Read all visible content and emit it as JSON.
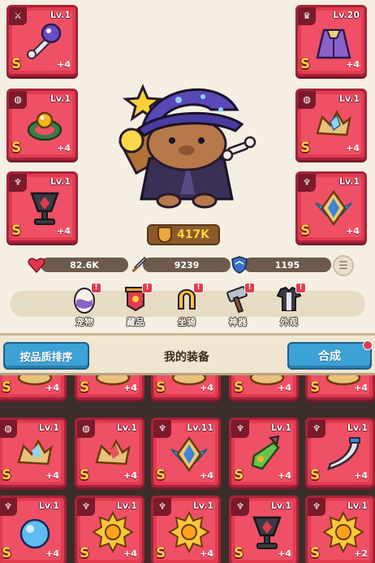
{
  "equipment": [
    {
      "id": "weapon",
      "type": "⚔",
      "level": "Lv.1",
      "grade": "S",
      "plus": "+4",
      "item": "scepter-icon"
    },
    {
      "id": "ring",
      "type": "◍",
      "level": "Lv.1",
      "grade": "S",
      "plus": "+4",
      "item": "ring-icon"
    },
    {
      "id": "trophy",
      "type": "♆",
      "level": "Lv.1",
      "grade": "S",
      "plus": "+4",
      "item": "trophy-icon"
    },
    {
      "id": "armor",
      "type": "♛",
      "level": "Lv.20",
      "grade": "S",
      "plus": "+4",
      "item": "cloak-icon"
    },
    {
      "id": "crown",
      "type": "◍",
      "level": "Lv.1",
      "grade": "S",
      "plus": "+4",
      "item": "crown-icon"
    },
    {
      "id": "necklace",
      "type": "♆",
      "level": "Lv.1",
      "grade": "S",
      "plus": "+4",
      "item": "necklace-icon"
    }
  ],
  "power": "417K",
  "stats": {
    "hp": "82.6K",
    "attack": "9239",
    "defense": "1195"
  },
  "features": [
    {
      "label": "宠物",
      "icon": "pet-egg-icon"
    },
    {
      "label": "藏品",
      "icon": "collection-banner-icon"
    },
    {
      "label": "坐骑",
      "icon": "mount-horseshoe-icon"
    },
    {
      "label": "神器",
      "icon": "artifact-hammer-icon"
    },
    {
      "label": "外观",
      "icon": "outfit-icon"
    }
  ],
  "bag_bar": {
    "sort_label": "按品质排序",
    "title": "我的装备",
    "merge_label": "合成"
  },
  "bag_rows": [
    [
      {
        "level": "",
        "grade": "S",
        "plus": "+4"
      },
      {
        "level": "",
        "grade": "S",
        "plus": "+4"
      },
      {
        "level": "",
        "grade": "S",
        "plus": "+4"
      },
      {
        "level": "",
        "grade": "S",
        "plus": "+4"
      },
      {
        "level": "",
        "grade": "S",
        "plus": "+4"
      }
    ],
    [
      {
        "level": "Lv.1",
        "grade": "S",
        "plus": "+4",
        "item": "crown-icon"
      },
      {
        "level": "Lv.1",
        "grade": "S",
        "plus": "+4",
        "item": "crown-icon"
      },
      {
        "level": "Lv.11",
        "grade": "S",
        "plus": "+4",
        "item": "necklace-icon"
      },
      {
        "level": "Lv.1",
        "grade": "S",
        "plus": "+4",
        "item": "potion-icon"
      },
      {
        "level": "Lv.1",
        "grade": "S",
        "plus": "+4",
        "item": "horn-icon"
      }
    ],
    [
      {
        "level": "Lv.1",
        "grade": "S",
        "plus": "+4",
        "item": "orb-icon"
      },
      {
        "level": "Lv.1",
        "grade": "S",
        "plus": "+4",
        "item": "sun-medal-icon"
      },
      {
        "level": "Lv.1",
        "grade": "S",
        "plus": "+4",
        "item": "sun-medal-icon"
      },
      {
        "level": "Lv.1",
        "grade": "S",
        "plus": "+4",
        "item": "trophy-icon"
      },
      {
        "level": "Lv.1",
        "grade": "S",
        "plus": "+2",
        "item": "sun-medal-icon"
      }
    ]
  ]
}
